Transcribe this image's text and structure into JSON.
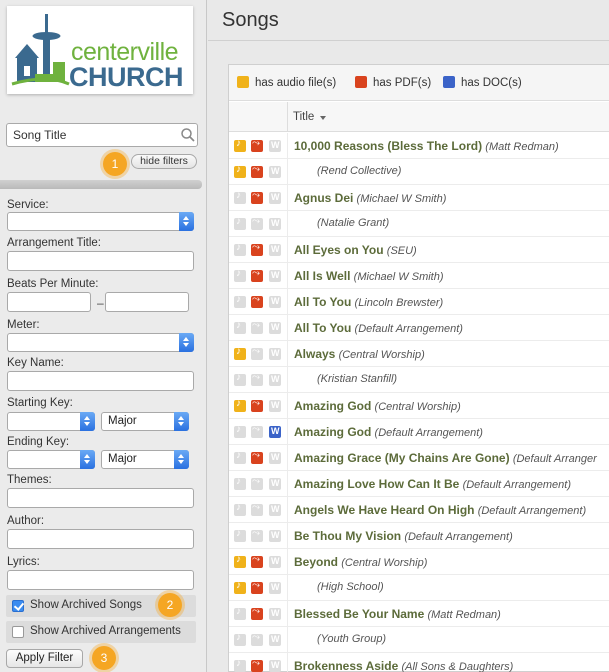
{
  "logo": {
    "line1": "centerville",
    "line2": "CHURCH"
  },
  "search": {
    "value": "Song Title"
  },
  "hide_filters_label": "hide filters",
  "badges": [
    "1",
    "2",
    "3"
  ],
  "filters": {
    "service_label": "Service:",
    "arrangement_title_label": "Arrangement Title:",
    "bpm_label": "Beats Per Minute:",
    "bpm_dash": "–",
    "meter_label": "Meter:",
    "key_name_label": "Key Name:",
    "starting_key_label": "Starting Key:",
    "starting_mode": "Major",
    "ending_key_label": "Ending Key:",
    "ending_mode": "Major",
    "themes_label": "Themes:",
    "author_label": "Author:",
    "lyrics_label": "Lyrics:",
    "show_archived_songs": "Show Archived Songs",
    "show_archived_songs_checked": true,
    "show_archived_arrangements": "Show Archived Arrangements",
    "show_archived_arrangements_checked": false,
    "apply_label": "Apply Filter"
  },
  "main": {
    "title": "Songs",
    "legend": {
      "audio": "has audio file(s)",
      "pdf": "has PDF(s)",
      "doc": "has DOC(s)"
    },
    "column_title": "Title",
    "rows": [
      {
        "name": "10,000 Reasons (Bless The Lord)",
        "arr": "(Matt Redman)",
        "audio": true,
        "pdf": true,
        "doc": false
      },
      {
        "name": "",
        "arr": "(Rend Collective)",
        "audio": true,
        "pdf": true,
        "doc": false
      },
      {
        "name": "Agnus Dei",
        "arr": "(Michael W Smith)",
        "audio": false,
        "pdf": true,
        "doc": false
      },
      {
        "name": "",
        "arr": "(Natalie Grant)",
        "audio": false,
        "pdf": false,
        "doc": false
      },
      {
        "name": "All Eyes on You",
        "arr": "(SEU)",
        "audio": false,
        "pdf": true,
        "doc": false
      },
      {
        "name": "All Is Well",
        "arr": "(Michael W Smith)",
        "audio": false,
        "pdf": true,
        "doc": false
      },
      {
        "name": "All To You",
        "arr": "(Lincoln Brewster)",
        "audio": false,
        "pdf": true,
        "doc": false
      },
      {
        "name": "All To You",
        "arr": "(Default Arrangement)",
        "audio": false,
        "pdf": false,
        "doc": false
      },
      {
        "name": "Always",
        "arr": "(Central Worship)",
        "audio": true,
        "pdf": false,
        "doc": false
      },
      {
        "name": "",
        "arr": "(Kristian Stanfill)",
        "audio": false,
        "pdf": false,
        "doc": false
      },
      {
        "name": "Amazing God",
        "arr": "(Central Worship)",
        "audio": true,
        "pdf": true,
        "doc": false
      },
      {
        "name": "Amazing God",
        "arr": "(Default Arrangement)",
        "audio": false,
        "pdf": false,
        "doc": true
      },
      {
        "name": "Amazing Grace (My Chains Are Gone)",
        "arr": "(Default Arranger",
        "audio": false,
        "pdf": true,
        "doc": false
      },
      {
        "name": "Amazing Love How Can It Be",
        "arr": "(Default Arrangement)",
        "audio": false,
        "pdf": false,
        "doc": false
      },
      {
        "name": "Angels We Have Heard On High",
        "arr": "(Default Arrangement)",
        "audio": false,
        "pdf": false,
        "doc": false
      },
      {
        "name": "Be Thou My Vision",
        "arr": "(Default Arrangement)",
        "audio": false,
        "pdf": false,
        "doc": false
      },
      {
        "name": "Beyond",
        "arr": "(Central Worship)",
        "audio": true,
        "pdf": true,
        "doc": false
      },
      {
        "name": "",
        "arr": "(High School)",
        "audio": true,
        "pdf": true,
        "doc": false
      },
      {
        "name": "Blessed Be Your Name",
        "arr": "(Matt Redman)",
        "audio": false,
        "pdf": true,
        "doc": false
      },
      {
        "name": "",
        "arr": "(Youth Group)",
        "audio": false,
        "pdf": false,
        "doc": false
      },
      {
        "name": "Brokenness Aside",
        "arr": "(All Sons & Daughters)",
        "audio": false,
        "pdf": true,
        "doc": false
      }
    ]
  },
  "colors": {
    "accent_badge": "#f5a623",
    "song_name": "#5c6b3a",
    "audio": "#f0b21a",
    "pdf": "#d9431e",
    "doc": "#3b63c8"
  }
}
